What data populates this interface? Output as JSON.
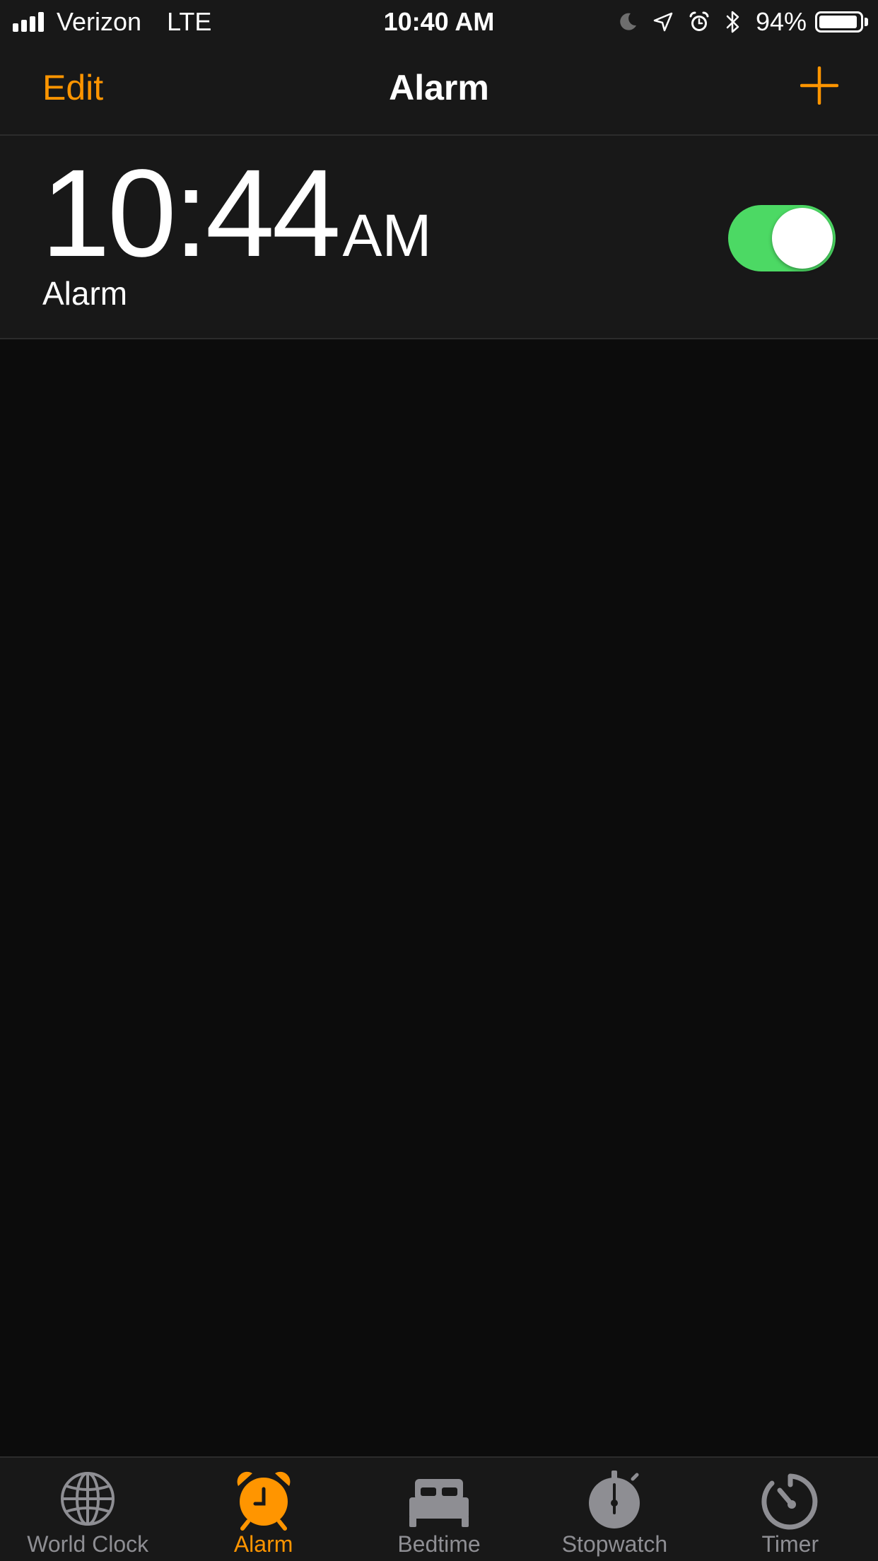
{
  "status_bar": {
    "carrier": "Verizon",
    "network": "LTE",
    "time": "10:40 AM",
    "battery_percent_label": "94%",
    "battery_level": 0.94,
    "icons": [
      "signal-bars-icon",
      "moon-icon",
      "location-arrow-icon",
      "alarm-clock-icon",
      "bluetooth-icon",
      "battery-icon"
    ]
  },
  "nav": {
    "edit_label": "Edit",
    "title": "Alarm",
    "add_icon": "plus-icon"
  },
  "alarms": [
    {
      "time": "10:44",
      "ampm": "AM",
      "label": "Alarm",
      "enabled": true
    }
  ],
  "tabs": [
    {
      "label": "World Clock",
      "icon": "globe-icon",
      "active": false
    },
    {
      "label": "Alarm",
      "icon": "alarm-clock-icon",
      "active": true
    },
    {
      "label": "Bedtime",
      "icon": "bed-icon",
      "active": false
    },
    {
      "label": "Stopwatch",
      "icon": "stopwatch-icon",
      "active": false
    },
    {
      "label": "Timer",
      "icon": "timer-icon",
      "active": false
    }
  ],
  "colors": {
    "accent": "#ff9500",
    "toggle_on": "#4cd964",
    "background": "#0c0c0c",
    "bar_background": "#181818",
    "inactive_tab": "#8e8e93"
  }
}
